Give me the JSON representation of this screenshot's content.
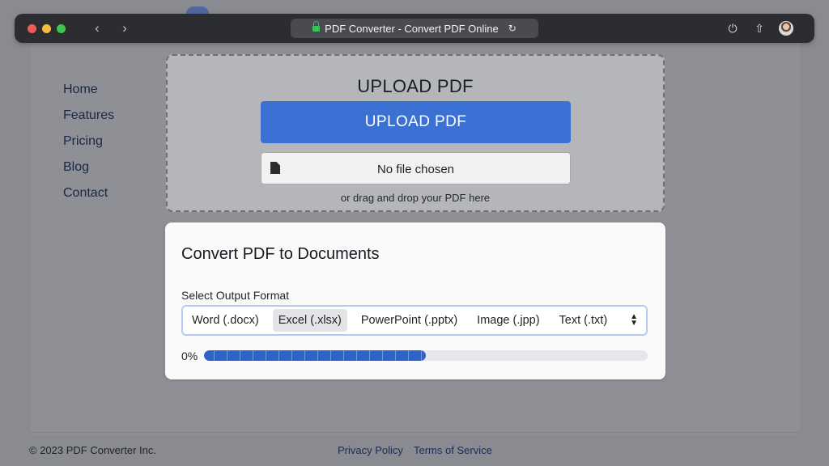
{
  "browser": {
    "title": "PDF Converter - Convert PDF Online",
    "icons": {
      "back": "chevron-left-icon",
      "forward": "chevron-right-icon",
      "lock": "lock-icon",
      "reload": "reload-icon",
      "power": "power-icon",
      "share": "share-icon"
    }
  },
  "sidebar": {
    "items": [
      {
        "label": "Home"
      },
      {
        "label": "Features"
      },
      {
        "label": "Pricing"
      },
      {
        "label": "Blog"
      },
      {
        "label": "Contact"
      }
    ]
  },
  "upload": {
    "title": "UPLOAD PDF",
    "button_label": "UPLOAD PDF",
    "file_status": "No file chosen",
    "drop_hint": "or drag and drop your PDF here"
  },
  "convert": {
    "title": "Convert PDF to Documents",
    "format_label": "Select Output Format",
    "formats": [
      {
        "label": "Word (.docx)",
        "selected": false
      },
      {
        "label": "Excel (.xlsx)",
        "selected": true
      },
      {
        "label": "PowerPoint (.pptx)",
        "selected": false
      },
      {
        "label": "Image (.jpp)",
        "selected": false
      },
      {
        "label": "Text (.txt)",
        "selected": false
      }
    ],
    "progress_text": "0%",
    "progress_fill_fraction": 0.5
  },
  "footer": {
    "copyright": "© 2023 PDF Converter Inc.",
    "links": [
      {
        "label": "Privacy Policy"
      },
      {
        "label": "Terms of Service"
      }
    ]
  },
  "colors": {
    "accent": "#3b71d4",
    "progress": "#2f63c8",
    "browser_bar": "#2c2d31"
  }
}
